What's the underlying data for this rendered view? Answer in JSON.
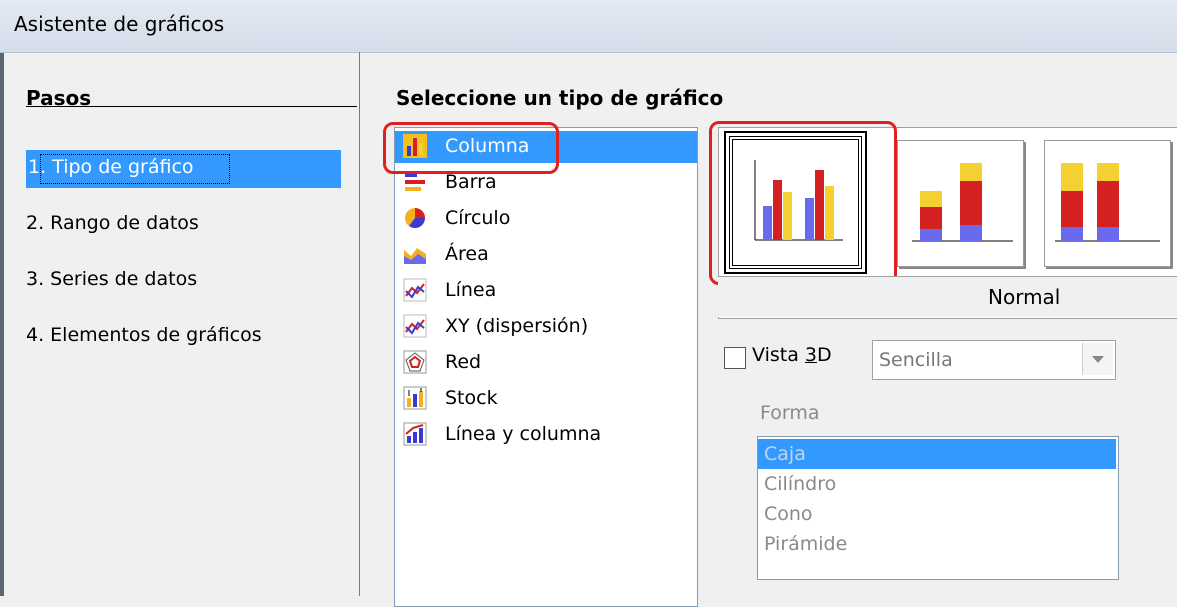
{
  "window": {
    "title": "Asistente de gráficos"
  },
  "steps": {
    "heading": "Pasos",
    "items": [
      "1. Tipo de gráfico",
      "2. Rango de datos",
      "3. Series de datos",
      "4. Elementos de gráficos"
    ]
  },
  "chart_types": {
    "heading": "Seleccione un tipo de gráfico",
    "items": [
      {
        "label": "Columna",
        "icon": "column-chart-icon"
      },
      {
        "label": "Barra",
        "icon": "bar-chart-icon"
      },
      {
        "label": "Círculo",
        "icon": "pie-chart-icon"
      },
      {
        "label": "Área",
        "icon": "area-chart-icon"
      },
      {
        "label": "Línea",
        "icon": "line-chart-icon"
      },
      {
        "label": "XY (dispersión)",
        "icon": "xy-chart-icon"
      },
      {
        "label": "Red",
        "icon": "net-chart-icon"
      },
      {
        "label": "Stock",
        "icon": "stock-chart-icon"
      },
      {
        "label": "Línea y columna",
        "icon": "line-column-chart-icon"
      }
    ]
  },
  "variants": {
    "caption": "Normal"
  },
  "view3d": {
    "label": "Vista 3D",
    "mnemonic": "3",
    "select_value": "Sencilla"
  },
  "shape": {
    "label": "Forma",
    "items": [
      "Caja",
      "Cilíndro",
      "Cono",
      "Pirámide"
    ]
  },
  "colors": {
    "selection": "#3399ff",
    "highlight_ring": "#e02020",
    "bar_blue": "#6a6aee",
    "bar_red": "#d42020",
    "bar_yellow": "#f5d033"
  }
}
